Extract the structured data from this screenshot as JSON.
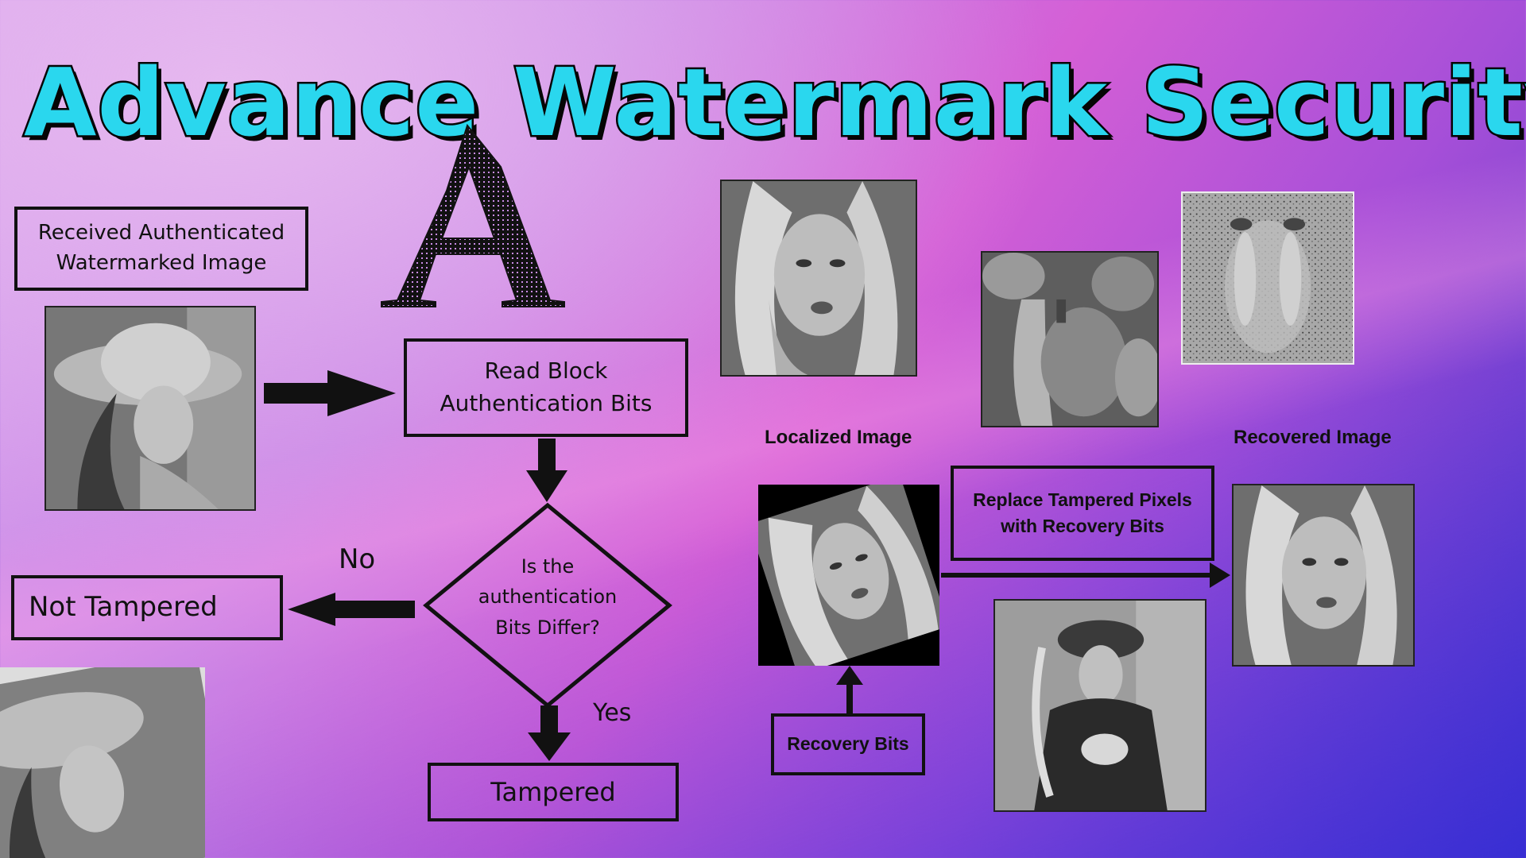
{
  "title": "Advance Watermark Security",
  "logo_letter": "A",
  "flowchart": {
    "received_label_line1": "Received Authenticated",
    "received_label_line2": "Watermarked Image",
    "read_block_line1": "Read Block",
    "read_block_line2": "Authentication Bits",
    "decision_line1": "Is the",
    "decision_line2": "authentication",
    "decision_line3": "Bits Differ?",
    "no_label": "No",
    "yes_label": "Yes",
    "not_tampered": "Not Tampered",
    "tampered": "Tampered"
  },
  "recovery": {
    "localized_label": "Localized Image",
    "recovered_label": "Recovered Image",
    "replace_line1": "Replace Tampered Pixels",
    "replace_line2": "with Recovery Bits",
    "recovery_bits": "Recovery Bits"
  },
  "colors": {
    "title_fill": "#2ad7ee",
    "outline": "#111111"
  }
}
